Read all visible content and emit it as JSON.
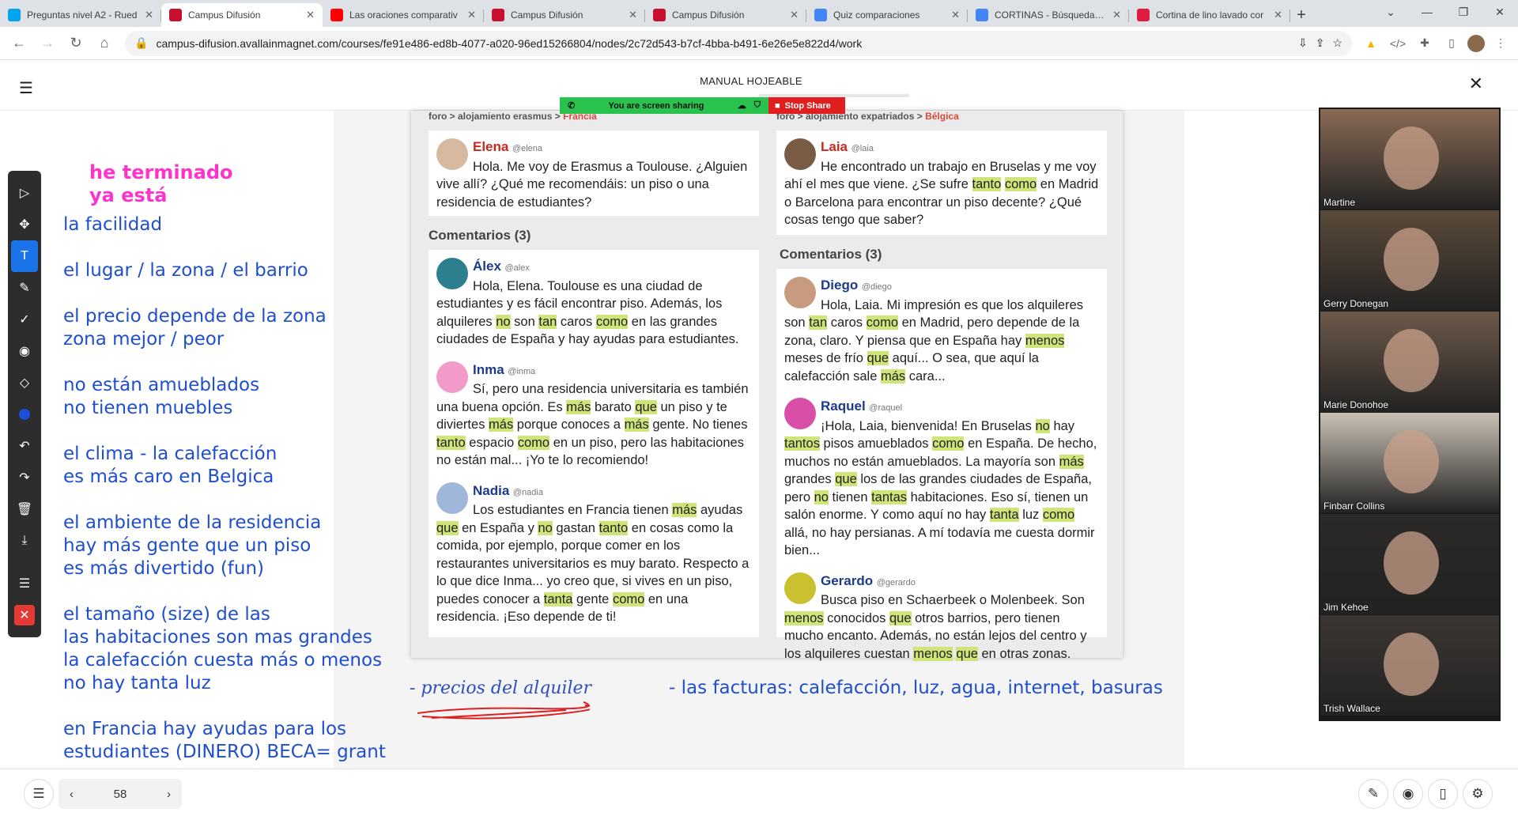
{
  "browser": {
    "tabs": [
      {
        "title": "Preguntas nivel A2 - Rued",
        "icon": "microsoft-icon",
        "color": "#00a4ef",
        "active": false
      },
      {
        "title": "Campus Difusión",
        "icon": "difusion-icon",
        "color": "#c8102e",
        "active": true
      },
      {
        "title": "Las oraciones comparativ",
        "icon": "youtube-icon",
        "color": "#ff0000",
        "active": false
      },
      {
        "title": "Campus Difusión",
        "icon": "difusion-icon",
        "color": "#c8102e",
        "active": false
      },
      {
        "title": "Campus Difusión",
        "icon": "difusion-icon",
        "color": "#c8102e",
        "active": false
      },
      {
        "title": "Quiz comparaciones",
        "icon": "google-icon",
        "color": "#4285f4",
        "active": false
      },
      {
        "title": "CORTINAS - Búsqueda de",
        "icon": "google-icon",
        "color": "#4285f4",
        "active": false
      },
      {
        "title": "Cortina de lino lavado cor",
        "icon": "store-icon",
        "color": "#e11d3f",
        "active": false
      }
    ],
    "url": "campus-difusion.avallainmagnet.com/courses/fe91e486-ed8b-4077-a020-96ed15266804/nodes/2c72d543-b7cf-4bba-b491-6e26e5e822d4/work"
  },
  "app": {
    "title": "MANUAL HOJEABLE",
    "page_number": "58"
  },
  "screenshare": {
    "status": "You are screen sharing",
    "stop": "Stop Share"
  },
  "book": {
    "left_header": {
      "prefix": "foro > alojamiento erasmus > ",
      "place": "Francia"
    },
    "right_header": {
      "prefix": "foro > alojamiento expatriados > ",
      "place": "Bélgica"
    },
    "left_post": {
      "name": "Elena",
      "handle": "@elena",
      "text": "Hola. Me voy de Erasmus a Toulouse. ¿Alguien vive allí? ¿Qué me recomendáis: un piso o una residencia de estudiantes?"
    },
    "right_post": {
      "name": "Laia",
      "handle": "@laia"
    },
    "comments_label": "Comentarios (3)",
    "left_comments": [
      {
        "name": "Álex",
        "handle": "@alex"
      },
      {
        "name": "Inma",
        "handle": "@inma"
      },
      {
        "name": "Nadia",
        "handle": "@nadia"
      }
    ],
    "right_comments": [
      {
        "name": "Diego",
        "handle": "@diego"
      },
      {
        "name": "Raquel",
        "handle": "@raquel"
      },
      {
        "name": "Gerardo",
        "handle": "@gerardo"
      }
    ]
  },
  "annotations": {
    "pink": [
      "he terminado",
      "ya está"
    ],
    "blue": [
      "la facilidad",
      "",
      "el lugar / la zona / el barrio",
      "",
      "el precio depende de la zona",
      "zona mejor / peor",
      "",
      "no están amueblados",
      "no tienen muebles",
      "",
      "el clima - la calefacción",
      "es más caro en Belgica",
      "",
      "el ambiente de la residencia",
      "hay más gente que un piso",
      "es más divertido (fun)",
      "",
      "el tamaño (size) de las",
      "las habitaciones son mas grandes",
      "la calefacción cuesta más o menos",
      "no hay tanta luz",
      "",
      "en Francia hay ayudas para los",
      "estudiantes (DINERO)    BECA= grant"
    ],
    "bills": "- las facturas: calefacción, luz, agua, internet, basuras",
    "handwritten": "- precios del alquiler"
  },
  "participants": [
    "Martine",
    "Gerry Donegan",
    "Marie Donohoe",
    "Finbarr Collins",
    "Jim Kehoe",
    "Trish Wallace"
  ]
}
